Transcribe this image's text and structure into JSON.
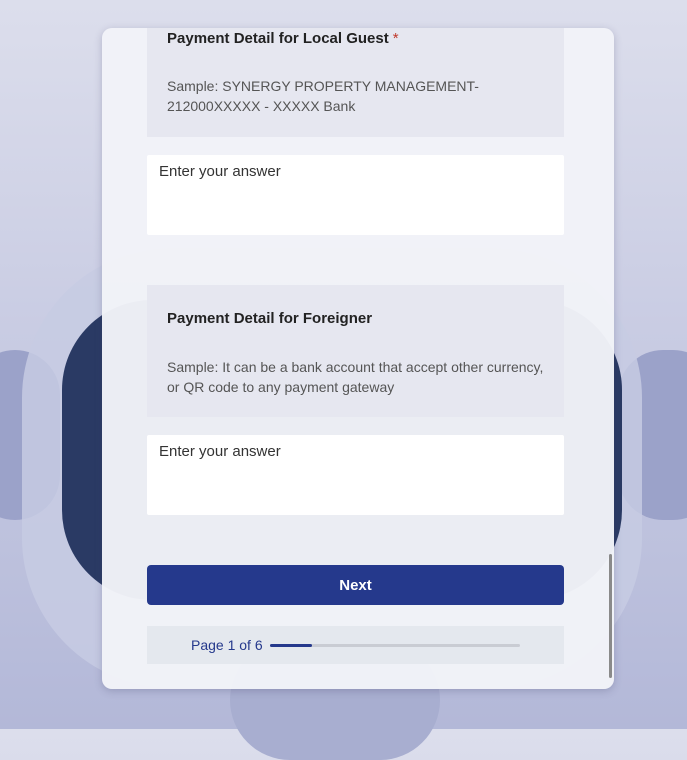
{
  "questions": [
    {
      "title": "Payment Detail for Local Guest",
      "required_mark": "*",
      "description": "Sample: SYNERGY PROPERTY MANAGEMENT- 212000XXXXX - XXXXX Bank",
      "answer_placeholder": "Enter your answer"
    },
    {
      "title": "Payment Detail for Foreigner",
      "description": "Sample: It can be a bank account that accept other currency, or QR code to any payment gateway",
      "answer_placeholder": "Enter your answer"
    }
  ],
  "next_label": "Next",
  "progress": {
    "label": "Page 1 of 6",
    "current_page": 1,
    "total_pages": 6,
    "fraction": 0.1667
  },
  "colors": {
    "accent": "#25398c",
    "required": "#c0392b"
  }
}
